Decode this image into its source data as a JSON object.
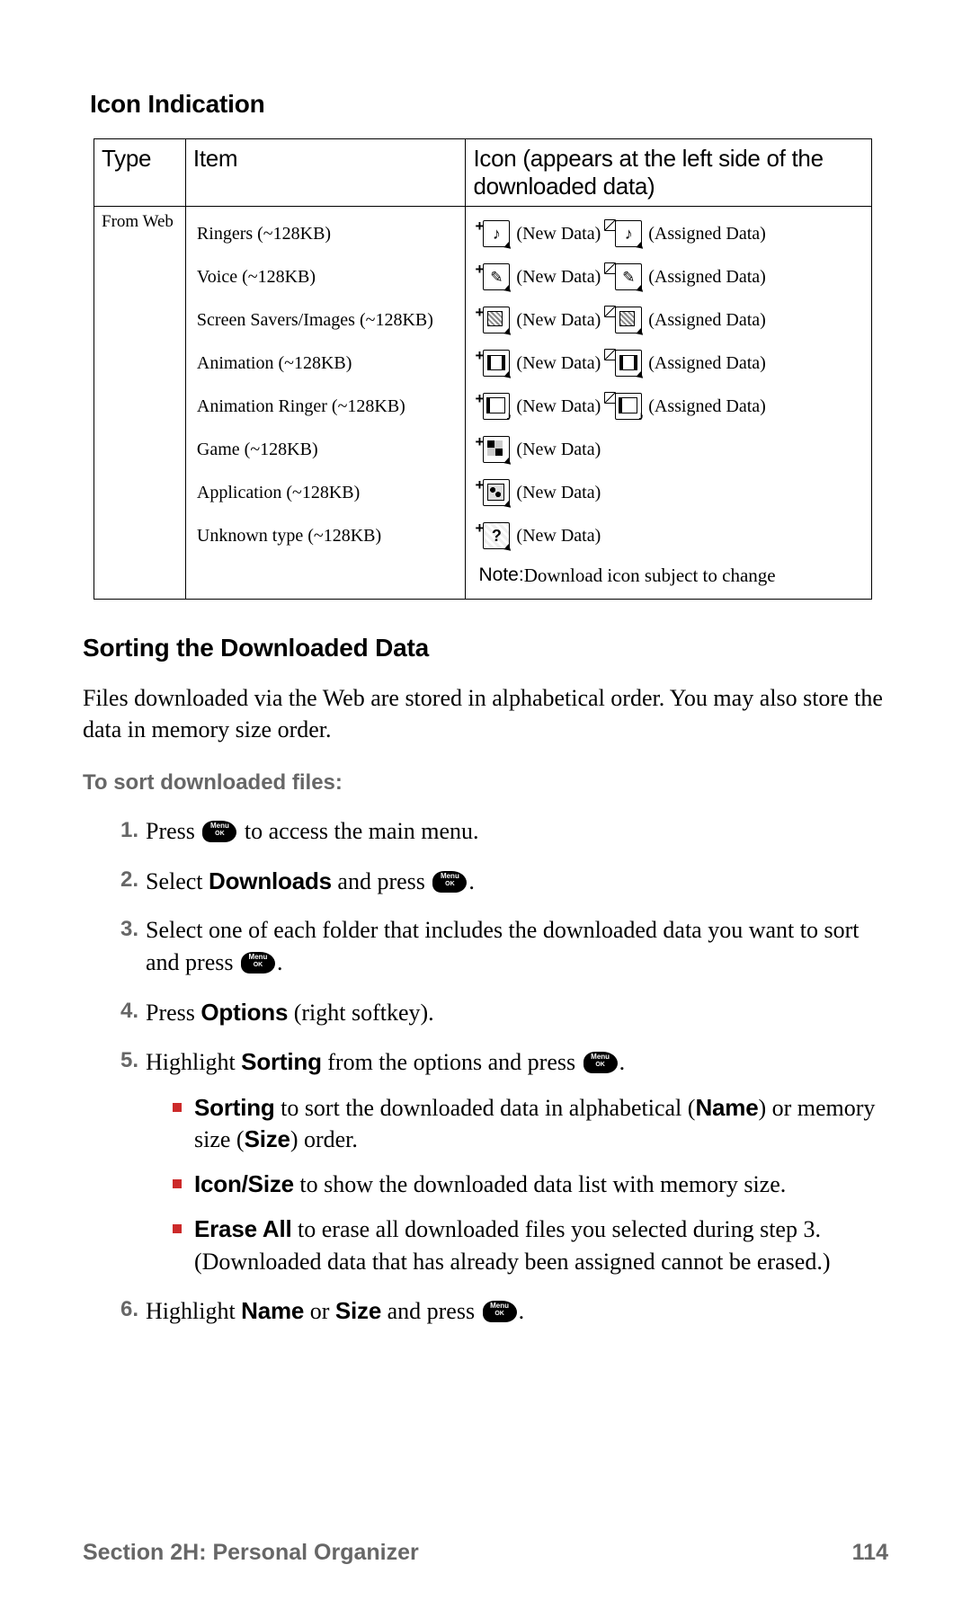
{
  "headings": {
    "icon_indication": "Icon Indication",
    "sorting": "Sorting the Downloaded Data"
  },
  "table": {
    "headers": {
      "type": "Type",
      "item": "Item",
      "icon": "Icon (appears at the left side of the downloaded data)"
    },
    "type_label": "From Web",
    "new_data_label": "(New Data)",
    "assigned_data_label": "(Assigned Data)",
    "rows": [
      {
        "item": "Ringers (~128KB)",
        "icon_kind": "note",
        "has_assigned": true
      },
      {
        "item": "Voice (~128KB)",
        "icon_kind": "voice",
        "has_assigned": true
      },
      {
        "item": "Screen Savers/Images (~128KB)",
        "icon_kind": "screen",
        "has_assigned": true
      },
      {
        "item": "Animation (~128KB)",
        "icon_kind": "anim",
        "has_assigned": true
      },
      {
        "item": "Animation Ringer (~128KB)",
        "icon_kind": "animring",
        "has_assigned": true
      },
      {
        "item": "Game (~128KB)",
        "icon_kind": "game",
        "has_assigned": false
      },
      {
        "item": "Application (~128KB)",
        "icon_kind": "app",
        "has_assigned": false
      },
      {
        "item": "Unknown type (~128KB)",
        "icon_kind": "unknown",
        "has_assigned": false
      }
    ],
    "note_label": "Note:",
    "note_text": " Download icon subject to change"
  },
  "body": {
    "intro": "Files downloaded via the Web are stored in alphabetical order. You may also store the data in memory size order.",
    "leadin": "To sort downloaded files:"
  },
  "steps": {
    "s1_a": "Press ",
    "s1_b": " to access the main menu.",
    "s2_a": "Select ",
    "s2_bold": "Downloads",
    "s2_b": " and press ",
    "s2_c": ".",
    "s3_a": "Select one of each folder that includes the downloaded data you want to sort and press ",
    "s3_b": ".",
    "s4_a": "Press ",
    "s4_bold": "Options",
    "s4_b": " (right softkey).",
    "s5_a": "Highlight ",
    "s5_bold": "Sorting",
    "s5_b": " from the options and press ",
    "s5_c": ".",
    "bullets": {
      "b1_bold": "Sorting",
      "b1_a": " to sort the downloaded data in alphabetical (",
      "b1_name": "Name",
      "b1_b": ") or memory size (",
      "b1_size": "Size",
      "b1_c": ") order.",
      "b2_bold": "Icon/Size",
      "b2_a": " to show the downloaded data list with memory size.",
      "b3_bold": "Erase All",
      "b3_a": " to erase all downloaded files you selected during step 3. (Downloaded data that has already been assigned cannot be erased.)"
    },
    "s6_a": "Highlight ",
    "s6_name": "Name",
    "s6_or": " or ",
    "s6_size": "Size",
    "s6_b": " and press ",
    "s6_c": "."
  },
  "footer": {
    "section": "Section 2H: Personal Organizer",
    "page": "114"
  }
}
